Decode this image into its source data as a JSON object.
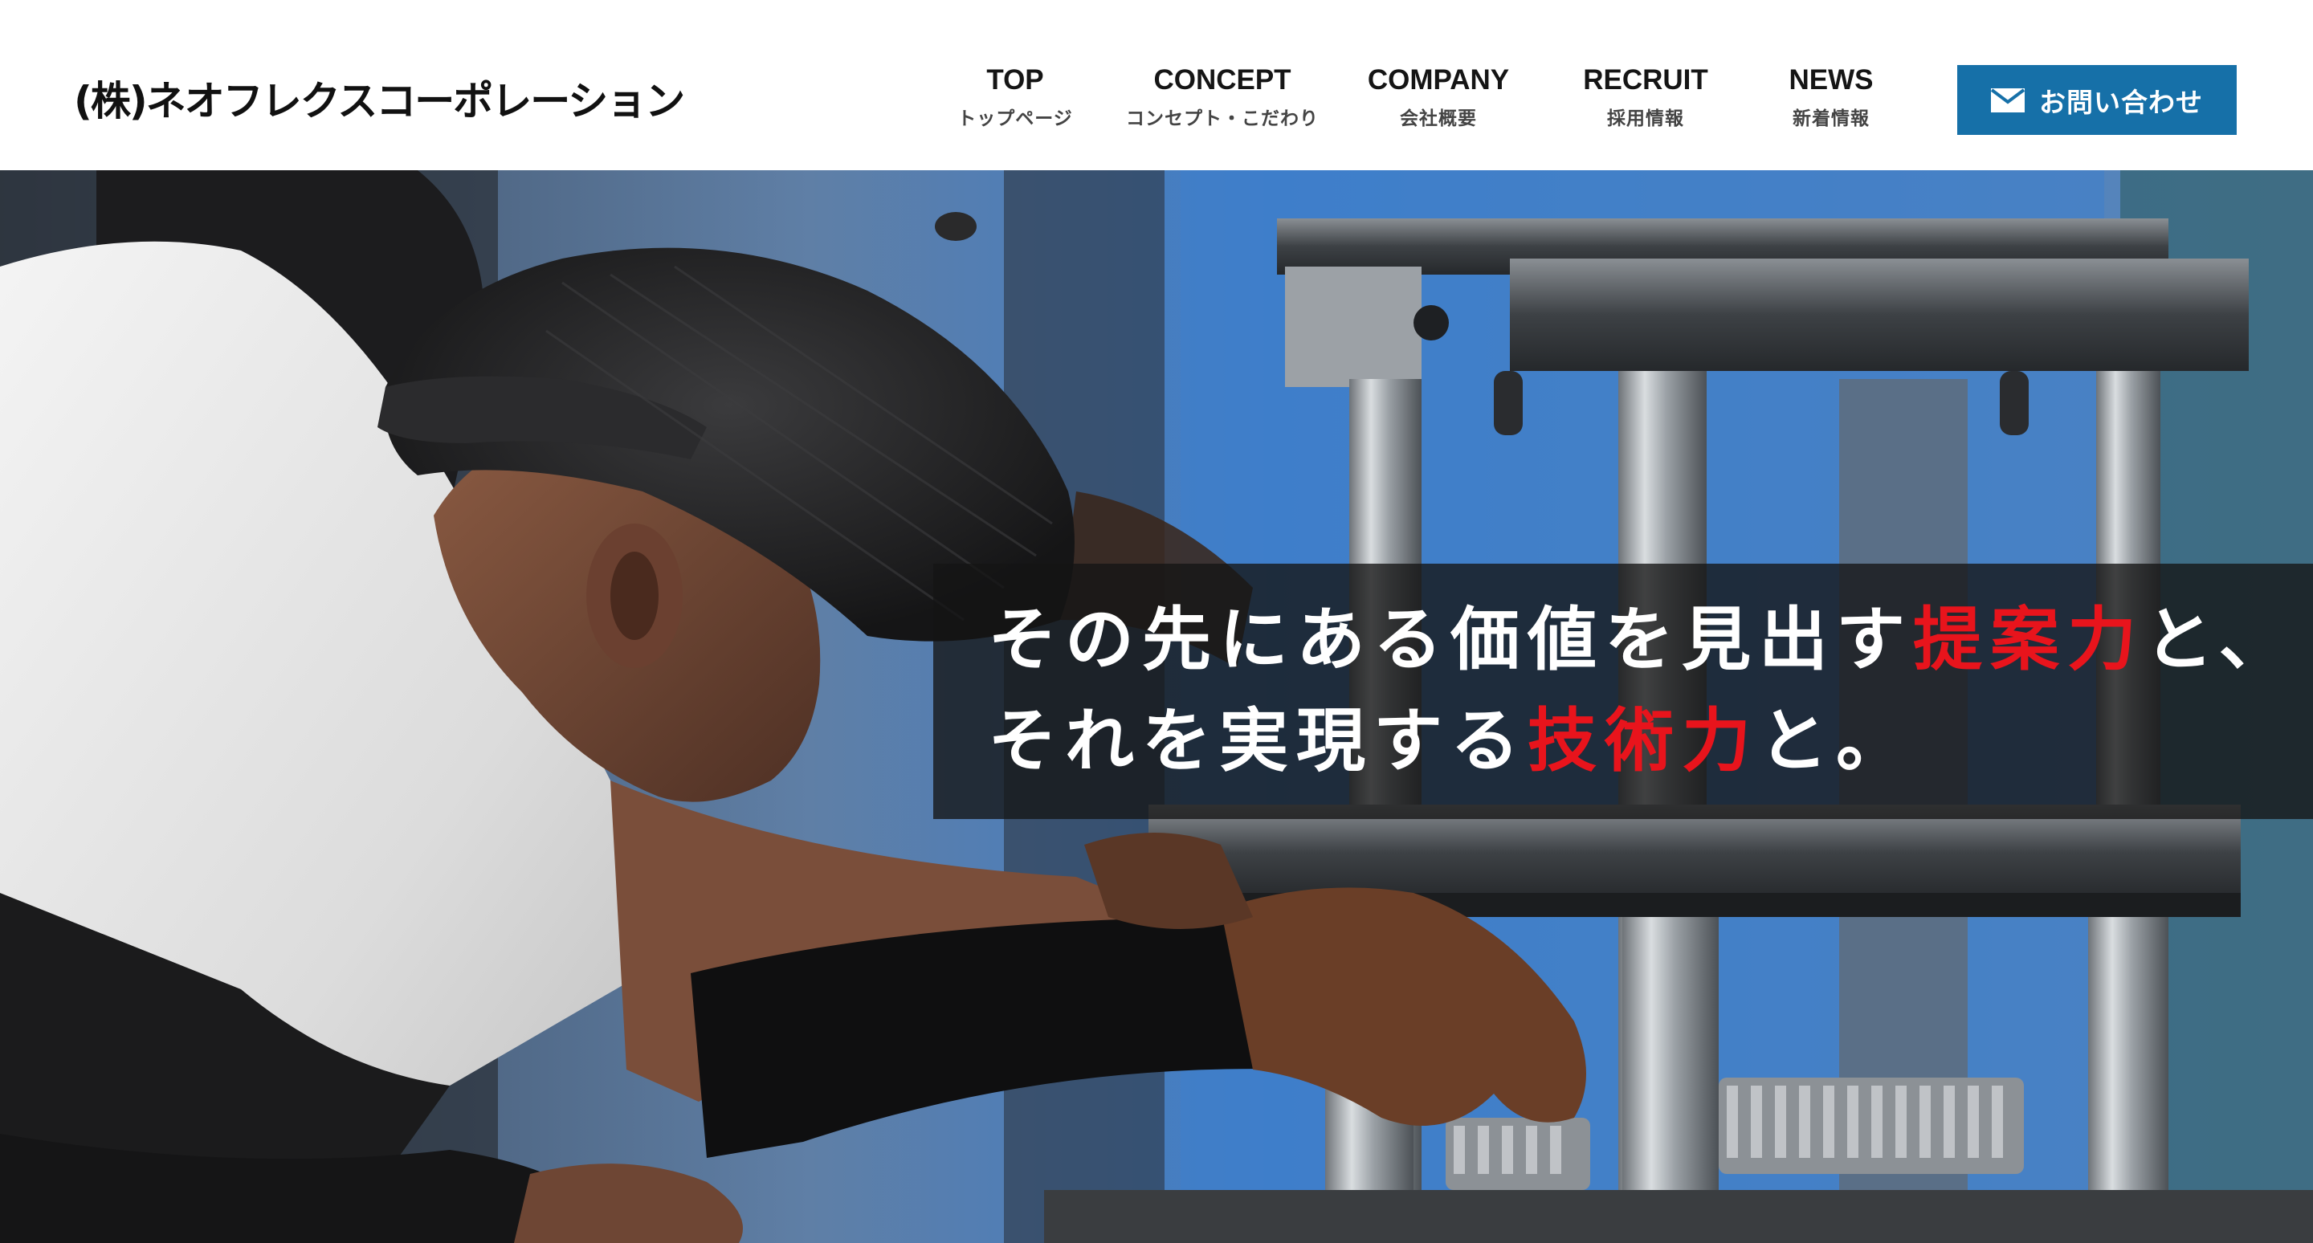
{
  "header": {
    "logo_text": "(株)ネオフレクスコーポレーション",
    "nav": [
      {
        "en": "TOP",
        "ja": "トップページ"
      },
      {
        "en": "CONCEPT",
        "ja": "コンセプト・こだわり"
      },
      {
        "en": "COMPANY",
        "ja": "会社概要"
      },
      {
        "en": "RECRUIT",
        "ja": "採用情報"
      },
      {
        "en": "NEWS",
        "ja": "新着情報"
      }
    ],
    "contact": {
      "label": "お問い合わせ",
      "icon": "mail-icon"
    }
  },
  "hero": {
    "line1": {
      "before": "その先にある価値を見出す",
      "accent": "提案力",
      "after": "と、"
    },
    "line2": {
      "before": "それを実現する",
      "accent": "技術力",
      "after": "と。"
    }
  },
  "colors": {
    "accent_red": "#e8141c",
    "button_blue": "#1670a8",
    "caption_bg": "rgba(20,20,20,0.78)"
  }
}
